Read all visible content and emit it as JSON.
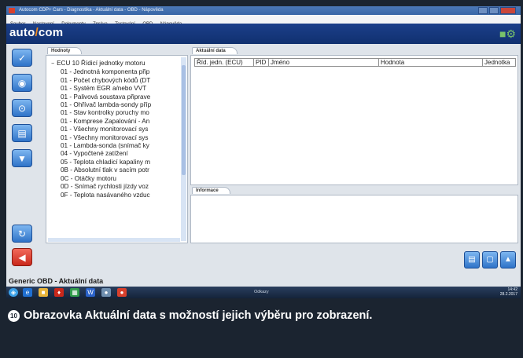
{
  "window": {
    "title": "Autocom CDP+ Cars - Diagnostika - Aktuální data - OBD - Nápověda",
    "menu": [
      "Soubor",
      "Nastavení",
      "Dokumenty",
      "Zpráva",
      "Testování",
      "OBD",
      "Nápověda"
    ]
  },
  "header": {
    "logo_left": "auto",
    "logo_sep": "/",
    "logo_right": "com"
  },
  "values_panel": {
    "tab": "Hodnoty",
    "root": "ECU 10 Řídicí jednotky motoru",
    "items": [
      "01 - Jednotná komponenta přip",
      "01 - Počet chybových kódů (DT",
      "01 - Systém EGR a/nebo VVT",
      "01 - Palivová soustava připrave",
      "01 - Ohřívač lambda-sondy příp",
      "01 - Stav kontrolky poruchy mo",
      "01 - Komprese Zapalování - An",
      "01 - Všechny monitorovací sys",
      "01 - Všechny monitorovací sys",
      "01 - Lambda-sonda (snímač ky",
      "04 - Vypočtené zatížení",
      "05 - Teplota chladicí kapaliny m",
      "0B - Absolutní tlak v sacím potr",
      "0C - Otáčky motoru",
      "0D - Snímač rychlosti jízdy voz",
      "0F - Teplota nasávaného vzduc"
    ]
  },
  "data_panel": {
    "tab": "Aktuální data",
    "columns": [
      "Říd. jedn. (ECU)",
      "PID",
      "Jméno",
      "Hodnota",
      "Jednotka"
    ]
  },
  "info_panel": {
    "tab": "Informace"
  },
  "status": {
    "text": "Generic OBD - Aktuální data"
  },
  "taskbar": {
    "label": "Odkazy",
    "time": "14:42",
    "date": "28.2.2017"
  },
  "caption": {
    "number": "10",
    "text": "Obrazovka Aktuální data s možností jejich výběru pro zobrazení."
  },
  "icons": [
    "app-icon",
    "check-icon",
    "camera-icon",
    "scan-icon",
    "filter-icon",
    "clipboard-icon",
    "chart-icon",
    "refresh-icon",
    "back-arrow-icon",
    "document-icon",
    "stop-icon",
    "trash-icon"
  ]
}
